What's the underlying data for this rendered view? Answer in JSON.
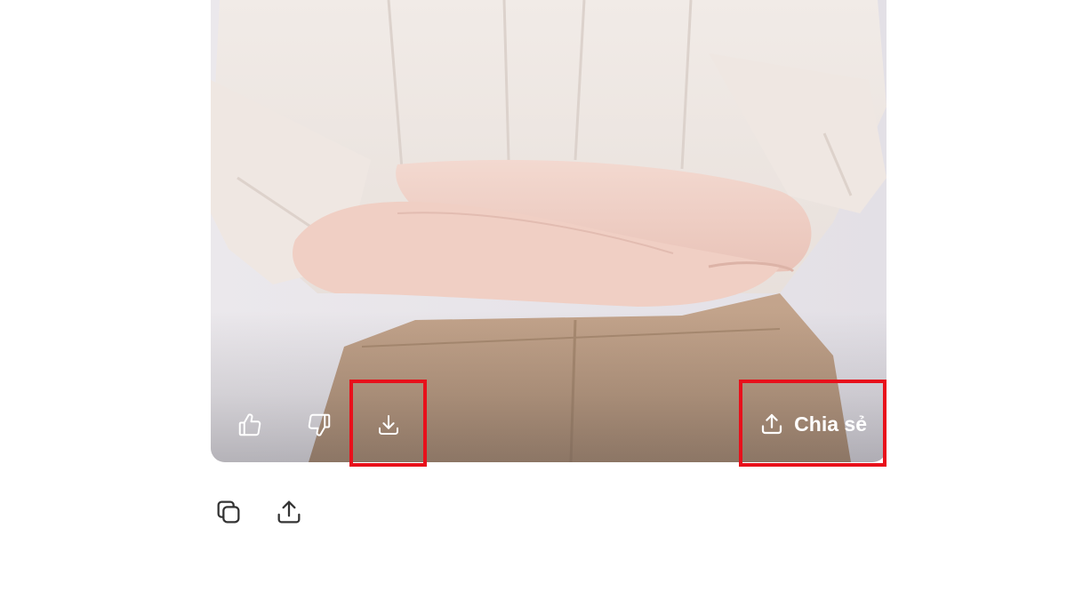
{
  "image_card": {
    "actions": [
      {
        "name": "like",
        "icon": "thumbs-up-icon"
      },
      {
        "name": "dislike",
        "icon": "thumbs-down-icon"
      },
      {
        "name": "download",
        "icon": "download-icon"
      }
    ],
    "share_label": "Chia sẻ",
    "share_icon": "upload-share-icon"
  },
  "below_actions": [
    {
      "name": "copy",
      "icon": "copy-icon"
    },
    {
      "name": "share",
      "icon": "share-icon"
    }
  ],
  "colors": {
    "highlight": "#e8101b",
    "icon_on_image": "#ffffff",
    "icon_below": "#333333"
  }
}
